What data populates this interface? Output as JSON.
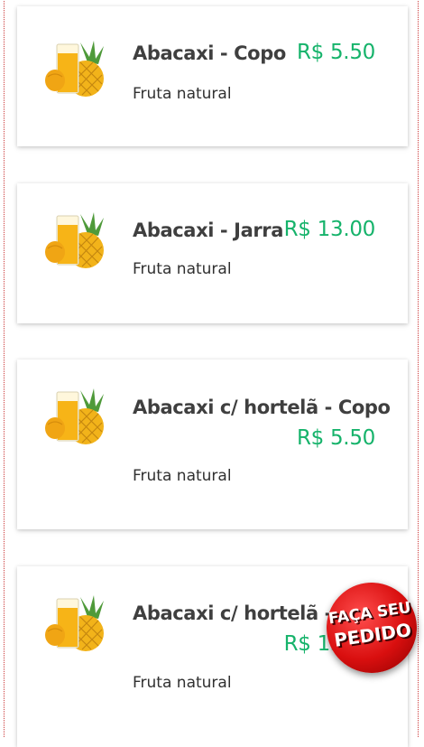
{
  "menu_items": [
    {
      "name": "Abacaxi - Copo",
      "description": "Fruta natural",
      "price": "R$ 5.50",
      "image": "pineapple-juice-icon"
    },
    {
      "name": "Abacaxi - Jarra",
      "description": "Fruta natural",
      "price": "R$ 13.00",
      "image": "pineapple-juice-icon"
    },
    {
      "name": "Abacaxi c/ hortelã - Copo",
      "description": "Fruta natural",
      "price": "R$ 5.50",
      "image": "pineapple-juice-icon"
    },
    {
      "name": "Abacaxi c/ hortelã - Jarra",
      "description": "Fruta natural",
      "price": "R$ 13.00",
      "image": "pineapple-juice-icon"
    }
  ],
  "order_button": {
    "line1": "FAÇA SEU",
    "line2": "PEDIDO"
  },
  "colors": {
    "price": "#16b36b",
    "border_dots": "#cc3b3b",
    "order_button": "#d90f0f"
  }
}
